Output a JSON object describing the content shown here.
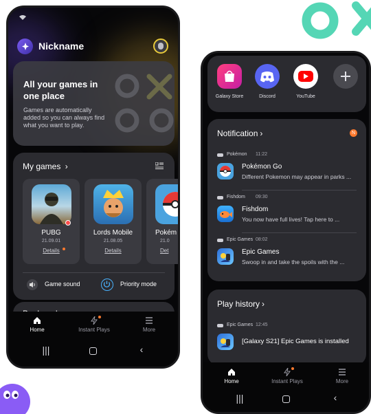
{
  "phone1": {
    "profile_name": "Nickname",
    "hero": {
      "title_line1": "All your games in",
      "title_line2": "one place",
      "desc_line1": "Games are automatically",
      "desc_line2": "added so you can always find",
      "desc_line3": "what you want to play."
    },
    "my_games": {
      "title": "My games",
      "games": [
        {
          "name": "PUBG",
          "date": "21.09.01",
          "details": "Details"
        },
        {
          "name": "Lords Mobile",
          "date": "21.08.05",
          "details": "Details"
        },
        {
          "name": "Pokém",
          "date": "21.0",
          "details": "Det"
        }
      ],
      "game_sound": "Game sound",
      "priority_mode": "Priority mode"
    },
    "bookmark": "Bookmark",
    "nav": {
      "home": "Home",
      "instant_plays": "Instant Plays",
      "more": "More"
    }
  },
  "phone2": {
    "apps": [
      {
        "label": "Galaxy Store",
        "color": "#e0287a"
      },
      {
        "label": "Discord",
        "color": "#5865f2"
      },
      {
        "label": "YouTube",
        "color": "#ff0000"
      }
    ],
    "notification": {
      "title": "Notification",
      "badge": "N",
      "items": [
        {
          "source": "Pokémon",
          "time": "11:22",
          "title": "Pokémon Go",
          "body": "Different Pokemon may appear in parks ..."
        },
        {
          "source": "Fishdom",
          "time": "09:30",
          "title": "Fishdom",
          "body": "You now have full lives! Tap here to ..."
        },
        {
          "source": "Epic Games",
          "time": "08:02",
          "title": "Epic Games",
          "body": "Swoop in and take the spoils with the ..."
        }
      ]
    },
    "play_history": {
      "title": "Play history",
      "item": {
        "source": "Epic Games",
        "time": "12:45",
        "title": "[Galaxy S21] Epic Games is installed"
      }
    },
    "nav": {
      "home": "Home",
      "instant_plays": "Instant Plays",
      "more": "More"
    }
  },
  "colors": {
    "accent_orange": "#ff7a2e",
    "mint": "#55d6b5",
    "purple": "#8a5cf5"
  }
}
